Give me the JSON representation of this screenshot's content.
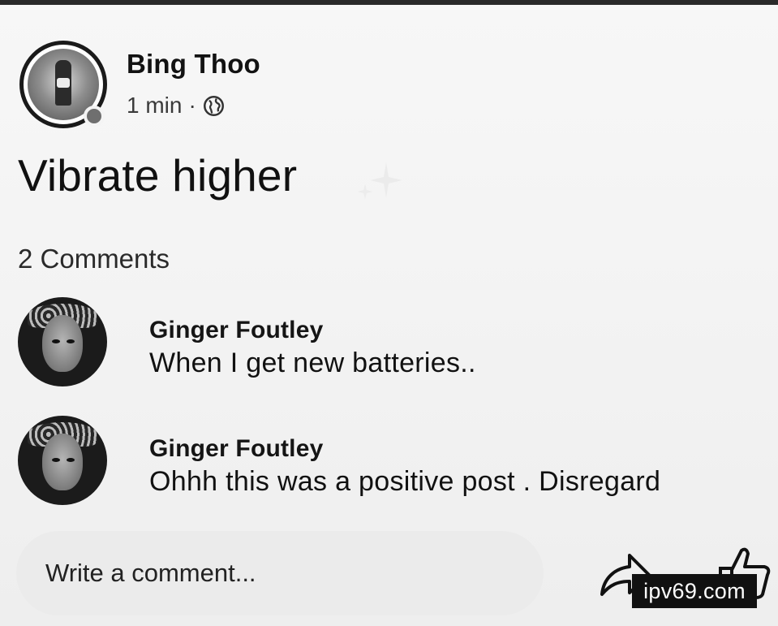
{
  "post": {
    "author": "Bing Thoo",
    "time": "1 min",
    "separator": "·",
    "visibility_icon": "globe-icon",
    "text": "Vibrate higher",
    "text_icon": "sparkle-icon",
    "comments_count": "2 Comments"
  },
  "comments": [
    {
      "author": "Ginger Foutley",
      "text": "When I get new batteries.."
    },
    {
      "author": "Ginger Foutley",
      "text": "Ohhh this was a positive post . Disregard"
    }
  ],
  "composer": {
    "placeholder": "Write a comment..."
  },
  "actions": {
    "share_icon": "share-icon",
    "like_icon": "thumbs-up-icon"
  },
  "watermark": "ipv69.com",
  "colors": {
    "background": "#f4f4f4",
    "text": "#111111",
    "composer_bg": "#ebebeb",
    "watermark_bg": "#111111"
  }
}
